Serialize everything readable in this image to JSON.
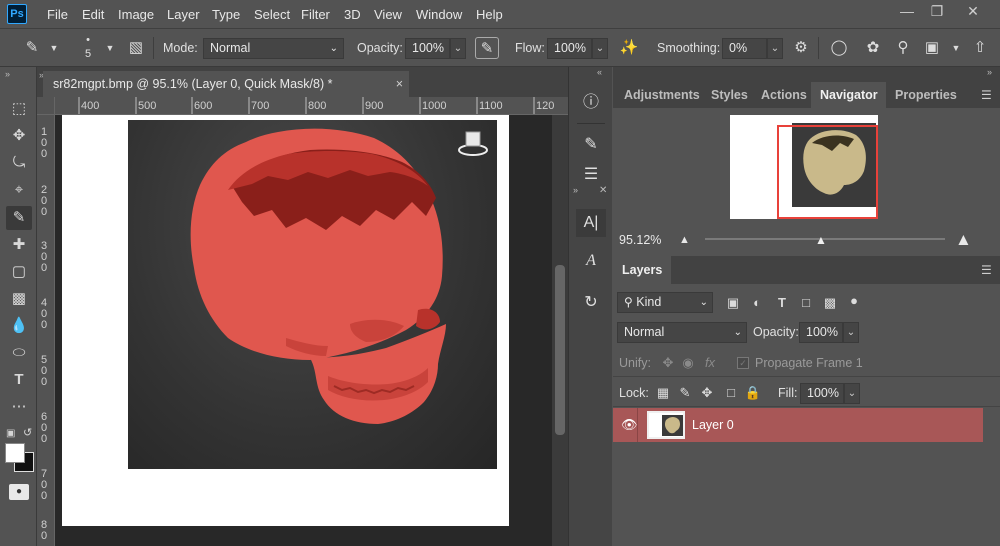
{
  "app": {
    "logo": "Ps"
  },
  "menu": [
    "File",
    "Edit",
    "Image",
    "Layer",
    "Type",
    "Select",
    "Filter",
    "3D",
    "View",
    "Window",
    "Help"
  ],
  "options": {
    "brush_size": "5",
    "mode_label": "Mode:",
    "mode_value": "Normal",
    "opacity_label": "Opacity:",
    "opacity_value": "100%",
    "flow_label": "Flow:",
    "flow_value": "100%",
    "smoothing_label": "Smoothing:",
    "smoothing_value": "0%"
  },
  "document": {
    "tab_title": "sr82mgpt.bmp @ 95.1% (Layer 0, Quick Mask/8) *",
    "close": "×",
    "ruler_top": [
      "400",
      "500",
      "600",
      "700",
      "800",
      "900",
      "1000",
      "1100",
      "120"
    ],
    "ruler_left": [
      "1 0 0",
      "2 0 0",
      "3 0 0",
      "4 0 0",
      "5 0 0",
      "6 0 0",
      "7 0 0",
      "8 0"
    ]
  },
  "navigator": {
    "tabs": [
      "Adjustments",
      "Styles",
      "Actions",
      "Navigator",
      "Properties"
    ],
    "active_tab": "Navigator",
    "zoom_value": "95.12%"
  },
  "layers": {
    "tab": "Layers",
    "filter_kind": "Kind",
    "blend_mode": "Normal",
    "opacity_label": "Opacity:",
    "opacity_value": "100%",
    "unify_label": "Unify:",
    "propagate_label": "Propagate Frame 1",
    "lock_label": "Lock:",
    "fill_label": "Fill:",
    "fill_value": "100%",
    "rows": [
      {
        "name": "Layer 0",
        "visible": true,
        "selected": true
      }
    ]
  },
  "colors": {
    "ui_bg": "#535353",
    "dark_panel": "#424242",
    "layer_selected": "#a85757",
    "quick_mask_red": "#e0574e",
    "canvas_dark": "#333333"
  }
}
